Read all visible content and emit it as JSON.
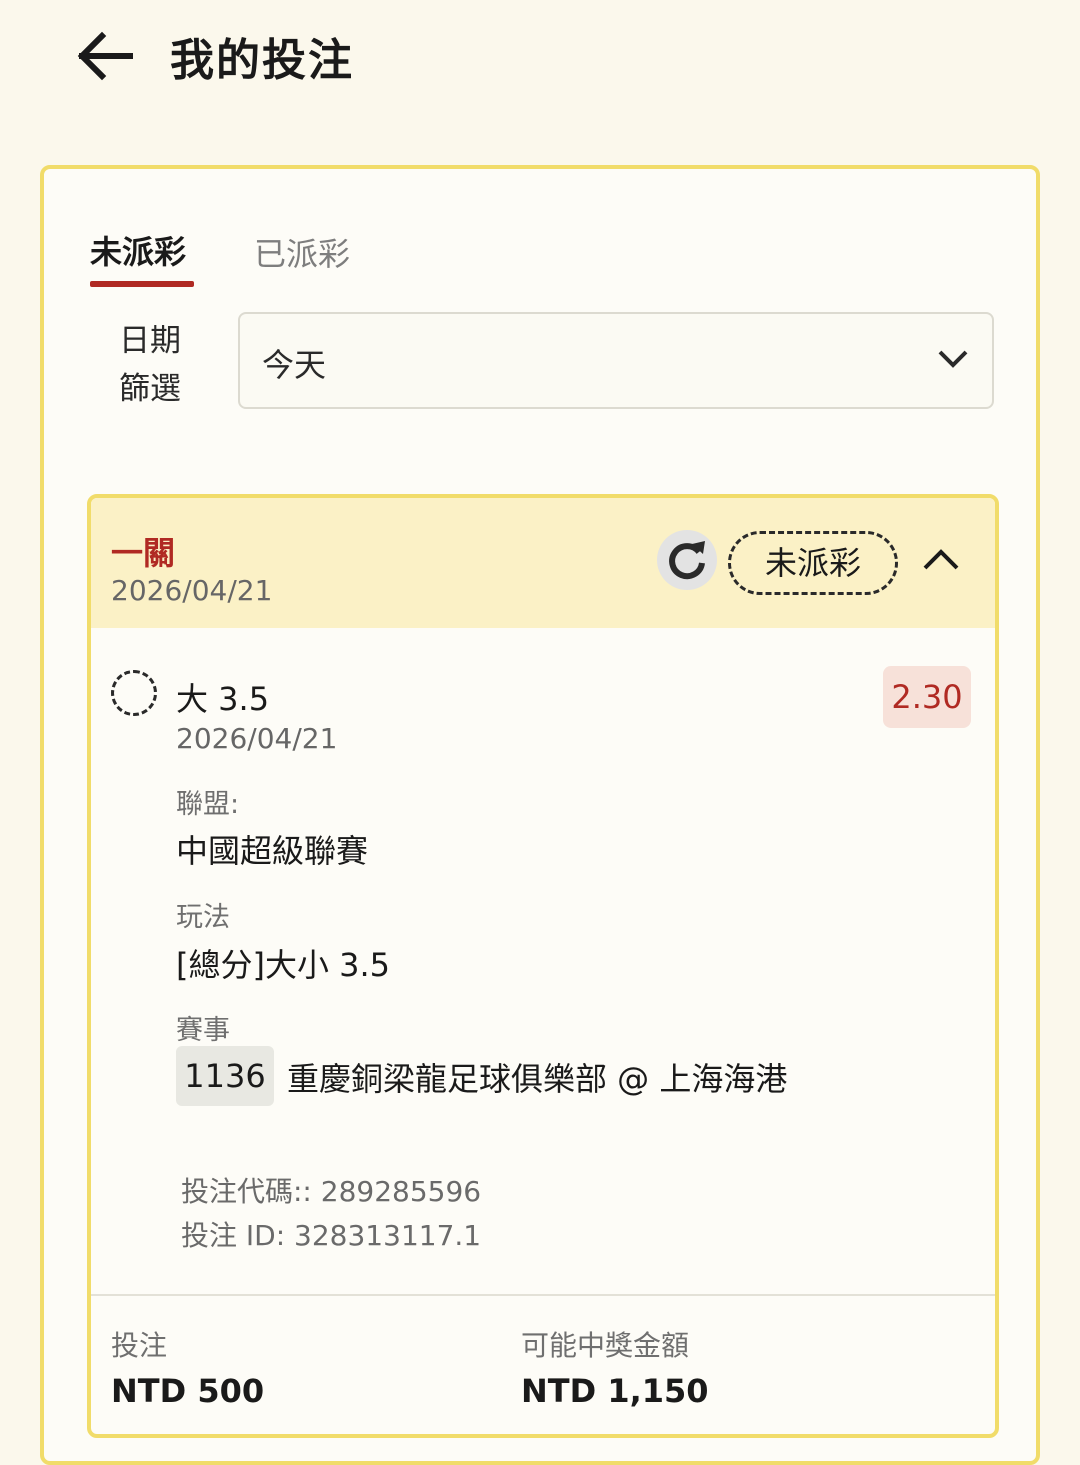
{
  "header": {
    "title": "我的投注"
  },
  "tabs": {
    "unsettled": "未派彩",
    "settled": "已派彩"
  },
  "filter": {
    "label": "日期篩選",
    "selected": "今天"
  },
  "bet": {
    "type": "一關",
    "date": "2026/04/21",
    "status": "未派彩",
    "selection": "大 3.5",
    "selection_date": "2026/04/21",
    "odds": "2.30",
    "league_label": "聯盟:",
    "league": "中國超級聯賽",
    "market_label": "玩法",
    "market": "[總分]大小 3.5",
    "event_label": "賽事",
    "match_id": "1136",
    "match": "重慶銅梁龍足球俱樂部 @ 上海海港",
    "bet_code": "投注代碼:: 289285596",
    "bet_id": "投注 ID: 328313117.1",
    "stake_label": "投注",
    "stake": "NTD 500",
    "payout_label": "可能中獎金額",
    "payout": "NTD 1,150"
  },
  "colors": {
    "accent": "#b02a23",
    "border": "#f1dc6a",
    "header_bg": "#fbf1c6"
  },
  "icons": {
    "back": "arrow-left-icon",
    "refresh": "refresh-icon",
    "dropdown": "chevron-down-icon",
    "collapse": "chevron-up-icon"
  }
}
